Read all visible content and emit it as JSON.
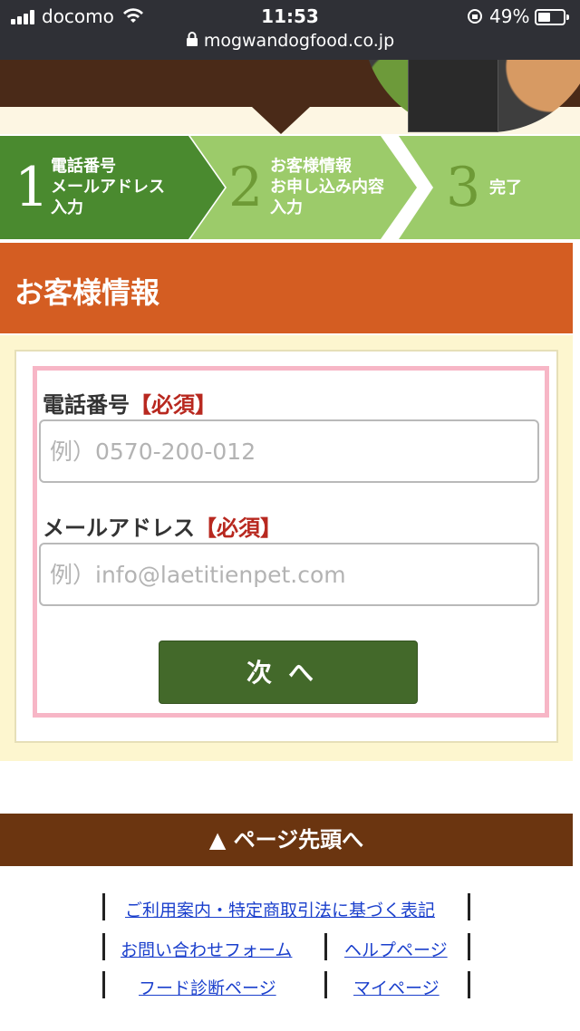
{
  "status": {
    "carrier": "docomo",
    "time": "11:53",
    "battery_pct": "49%",
    "battery_level": 0.49,
    "signal_bars": 4,
    "url": "mogwandogfood.co.jp"
  },
  "steps": [
    {
      "num": "1",
      "label_lines": [
        "電話番号",
        "メールアドレス",
        "入力"
      ],
      "color": "#4a8a2f"
    },
    {
      "num": "2",
      "label_lines": [
        "お客様情報",
        "お申し込み内容",
        "入力"
      ],
      "color": "#9ccb6a"
    },
    {
      "num": "3",
      "label_lines": [
        "完了"
      ],
      "color": "#9ccb6a"
    }
  ],
  "section": {
    "title": "お客様情報"
  },
  "form": {
    "phone": {
      "label": "電話番号",
      "required": "【必須】",
      "placeholder": "例）0570-200-012",
      "value": ""
    },
    "email": {
      "label": "メールアドレス",
      "required": "【必須】",
      "placeholder": "例）info@laetitienpet.com",
      "value": ""
    },
    "next_button": "次へ"
  },
  "pagetop": {
    "label": "▲ ページ先頭へ"
  },
  "footer": {
    "links": [
      "ご利用案内・特定商取引法に基づく表記",
      "お問い合わせフォーム",
      "ヘルプページ",
      "フード診断ページ",
      "マイページ"
    ]
  },
  "colors": {
    "section_orange": "#d45d22",
    "form_pink_border": "#f7b6c6",
    "button_green": "#43692a",
    "pagetop_brown": "#6b3510",
    "required_red": "#b8281f"
  }
}
